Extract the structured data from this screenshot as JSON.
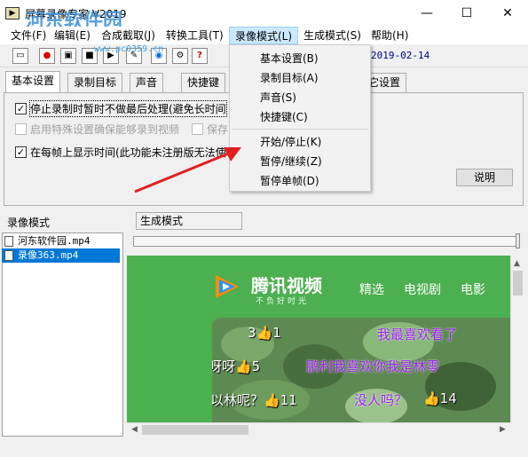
{
  "window": {
    "title": "屏幕录像专家 V2019",
    "controls": [
      "—",
      "☐",
      "✕"
    ],
    "watermark": "河东软件园",
    "watermark_url": "www.pc0359.cn"
  },
  "menubar": [
    "文件(F)",
    "编辑(E)",
    "合成截取(J)",
    "转换工具(T)",
    "录像模式(L)",
    "生成模式(S)",
    "帮助(H)"
  ],
  "toolbar": {
    "date": "2019-02-14"
  },
  "tabs": [
    "基本设置",
    "录制目标",
    "声音",
    "快捷键",
    "其它设置"
  ],
  "options": [
    {
      "label": "停止录制时暂时不做最后处理(避免长时间",
      "checked": true,
      "disabled": false
    },
    {
      "label": "启用特殊设置确保能够录到视频",
      "checked": false,
      "disabled": true
    },
    {
      "label": "保存",
      "checked": false,
      "disabled": true
    },
    {
      "label": "在每帧上显示时间(此功能未注册版无法使",
      "checked": true,
      "disabled": false
    }
  ],
  "help_button": "说明",
  "dropdown": {
    "group1": [
      "基本设置(B)",
      "录制目标(A)",
      "声音(S)",
      "快捷键(C)"
    ],
    "group2": [
      "开始/停止(K)",
      "暂停/继续(Z)",
      "暂停单帧(D)"
    ]
  },
  "lower": {
    "left_label": "录像模式",
    "tab": "生成模式",
    "files": [
      "河东软件园.mp4",
      "录像363.mp4"
    ]
  },
  "video": {
    "brand": "腾讯视频",
    "slogan": "不负好时光",
    "nav": [
      "精选",
      "电视剧",
      "电影"
    ],
    "danmu": [
      {
        "text": "3👍1",
        "style": "white"
      },
      {
        "text": "我最喜欢看了",
        "style": "purple"
      },
      {
        "text": "呀呀👍5",
        "style": "white"
      },
      {
        "text": "鹏利我喜欢你我是林零",
        "style": "purple"
      },
      {
        "text": "以林呢？👍11",
        "style": "white"
      },
      {
        "text": "没人吗？",
        "style": "purple"
      },
      {
        "text": "👍14",
        "style": "white"
      }
    ]
  },
  "colors": {
    "accent": "#0078d7",
    "menu_highlight": "#cce8ff",
    "video_bg": "#4caf50",
    "arrow": "#e02020"
  }
}
